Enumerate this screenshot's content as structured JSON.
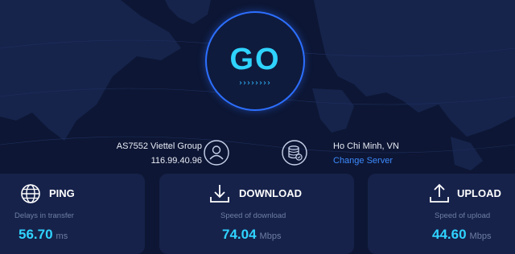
{
  "start": {
    "label": "GO",
    "arrows": "››››››››"
  },
  "isp": {
    "name": "AS7552 Viettel Group",
    "ip": "116.99.40.96"
  },
  "server": {
    "location": "Ho Chi Minh, VN",
    "change_label": "Change Server"
  },
  "metrics": {
    "ping": {
      "title": "PING",
      "subtitle": "Delays in transfer",
      "value": "56.70",
      "unit": "ms"
    },
    "download": {
      "title": "DOWNLOAD",
      "subtitle": "Speed of download",
      "value": "74.04",
      "unit": "Mbps"
    },
    "upload": {
      "title": "UPLOAD",
      "subtitle": "Speed of upload",
      "value": "44.60",
      "unit": "Mbps"
    }
  },
  "colors": {
    "background": "#0d1634",
    "card": "#16224a",
    "accent": "#2fd3ff",
    "link": "#3d8bff",
    "ring": "#2c6fff",
    "muted": "#6f7ea6"
  }
}
